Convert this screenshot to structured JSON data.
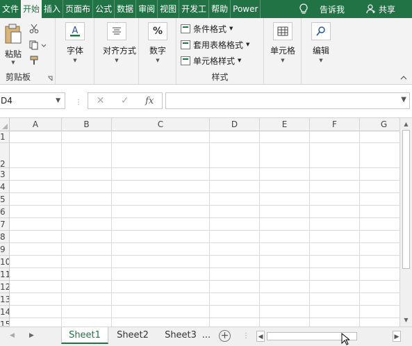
{
  "ribbon_tabs": [
    {
      "label": "文件",
      "active": false
    },
    {
      "label": "开始",
      "active": true
    },
    {
      "label": "插入",
      "active": false
    },
    {
      "label": "页面布",
      "active": false
    },
    {
      "label": "公式",
      "active": false
    },
    {
      "label": "数据",
      "active": false
    },
    {
      "label": "审阅",
      "active": false
    },
    {
      "label": "视图",
      "active": false
    },
    {
      "label": "开发工",
      "active": false
    },
    {
      "label": "帮助",
      "active": false
    },
    {
      "label": "Power",
      "active": false
    }
  ],
  "tell_me": "告诉我",
  "share": "共享",
  "groups": {
    "clipboard": {
      "label": "剪贴板",
      "paste": "粘贴"
    },
    "font": {
      "label": "字体"
    },
    "alignment": {
      "label": "对齐方式"
    },
    "number": {
      "label": "数字",
      "icon_text": "%"
    },
    "styles": {
      "label": "样式",
      "conditional": "条件格式",
      "table": "套用表格格式",
      "cell_styles": "单元格样式"
    },
    "cells": {
      "label": "单元格"
    },
    "editing": {
      "label": "编辑"
    }
  },
  "formula_bar": {
    "name_box": "D4",
    "fx": "fx",
    "formula": ""
  },
  "columns": [
    "A",
    "B",
    "C",
    "D",
    "E",
    "F",
    "G"
  ],
  "rows": [
    "1",
    "2",
    "3",
    "4",
    "5",
    "6",
    "7",
    "8",
    "9",
    "10",
    "11",
    "12",
    "13",
    "14",
    "15"
  ],
  "sheets": [
    {
      "label": "Sheet1",
      "active": true
    },
    {
      "label": "Sheet2",
      "active": false
    },
    {
      "label": "Sheet3",
      "active": false
    }
  ],
  "sheet_more": "...",
  "colors": {
    "accent": "#217346",
    "ribbon_bg": "#f3f3f3",
    "grid_line": "#dadada"
  }
}
